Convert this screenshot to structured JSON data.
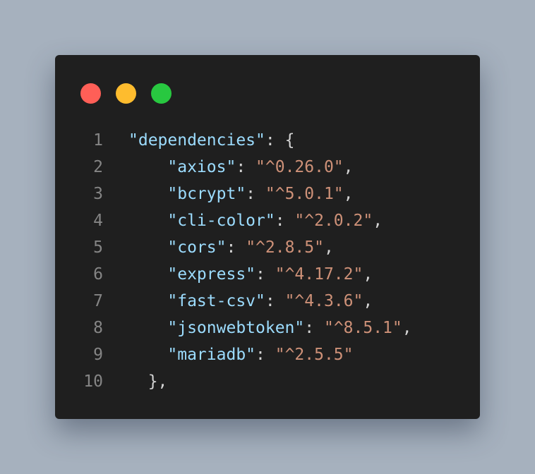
{
  "window": {
    "controls": [
      {
        "name": "close-dot",
        "color": "#ff5f57"
      },
      {
        "name": "minimize-dot",
        "color": "#febc2e"
      },
      {
        "name": "maximize-dot",
        "color": "#28c840"
      }
    ]
  },
  "code": {
    "lines": [
      {
        "num": "1",
        "indent": "",
        "key": "\"dependencies\"",
        "sep": ": ",
        "value": "",
        "tail": "{"
      },
      {
        "num": "2",
        "indent": "    ",
        "key": "\"axios\"",
        "sep": ": ",
        "value": "\"^0.26.0\"",
        "tail": ","
      },
      {
        "num": "3",
        "indent": "    ",
        "key": "\"bcrypt\"",
        "sep": ": ",
        "value": "\"^5.0.1\"",
        "tail": ","
      },
      {
        "num": "4",
        "indent": "    ",
        "key": "\"cli-color\"",
        "sep": ": ",
        "value": "\"^2.0.2\"",
        "tail": ","
      },
      {
        "num": "5",
        "indent": "    ",
        "key": "\"cors\"",
        "sep": ": ",
        "value": "\"^2.8.5\"",
        "tail": ","
      },
      {
        "num": "6",
        "indent": "    ",
        "key": "\"express\"",
        "sep": ": ",
        "value": "\"^4.17.2\"",
        "tail": ","
      },
      {
        "num": "7",
        "indent": "    ",
        "key": "\"fast-csv\"",
        "sep": ": ",
        "value": "\"^4.3.6\"",
        "tail": ","
      },
      {
        "num": "8",
        "indent": "    ",
        "key": "\"jsonwebtoken\"",
        "sep": ": ",
        "value": "\"^8.5.1\"",
        "tail": ","
      },
      {
        "num": "9",
        "indent": "    ",
        "key": "\"mariadb\"",
        "sep": ": ",
        "value": "\"^2.5.5\"",
        "tail": ""
      },
      {
        "num": "10",
        "indent": "  ",
        "key": "",
        "sep": "",
        "value": "",
        "tail": "},"
      }
    ]
  }
}
